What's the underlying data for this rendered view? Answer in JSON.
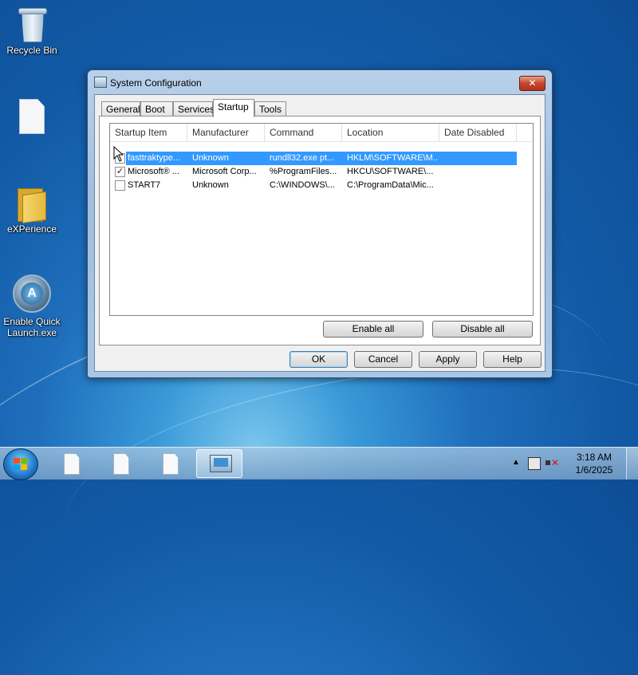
{
  "desktop": {
    "icons": [
      {
        "label": "Recycle Bin",
        "icon": "recycle-bin-icon"
      },
      {
        "label": "",
        "icon": "file-icon"
      },
      {
        "label": "eXPerience",
        "icon": "folder-icon"
      },
      {
        "label": "Enable Quick Launch.exe",
        "icon": "quick-launch-icon"
      }
    ]
  },
  "dialog": {
    "title": "System Configuration",
    "close_label": "✕",
    "tabs": [
      {
        "label": "General",
        "active": false
      },
      {
        "label": "Boot",
        "active": false
      },
      {
        "label": "Services",
        "active": false
      },
      {
        "label": "Startup",
        "active": true
      },
      {
        "label": "Tools",
        "active": false
      }
    ],
    "columns": [
      "Startup Item",
      "Manufacturer",
      "Command",
      "Location",
      "Date Disabled"
    ],
    "rows": [
      {
        "checked": false,
        "selected": true,
        "item": "fasttraktype...",
        "manufacturer": "Unknown",
        "command": "rundll32.exe pt...",
        "location": "HKLM\\SOFTWARE\\M...",
        "date_disabled": ""
      },
      {
        "checked": true,
        "selected": false,
        "item": "Microsoft® ...",
        "manufacturer": "Microsoft Corp...",
        "command": "%ProgramFiles...",
        "location": "HKCU\\SOFTWARE\\...",
        "date_disabled": ""
      },
      {
        "checked": false,
        "selected": false,
        "item": "START7",
        "manufacturer": "Unknown",
        "command": "C:\\WINDOWS\\...",
        "location": "C:\\ProgramData\\Mic...",
        "date_disabled": ""
      }
    ],
    "enable_all_label": "Enable all",
    "disable_all_label": "Disable all",
    "ok_label": "OK",
    "cancel_label": "Cancel",
    "apply_label": "Apply",
    "help_label": "Help"
  },
  "taskbar": {
    "start_icon": "windows-start-icon",
    "buttons": [
      {
        "icon": "file-icon",
        "active": false
      },
      {
        "icon": "file-icon",
        "active": false
      },
      {
        "icon": "file-icon",
        "active": false
      },
      {
        "icon": "system-configuration-icon",
        "active": true
      }
    ],
    "tray": {
      "overflow_label": "▲",
      "time": "3:18 AM",
      "date": "1/6/2025"
    }
  },
  "colors": {
    "selection": "#3399ff",
    "close_button": "#c7452d",
    "desktop_accent": "#1f6fbd"
  }
}
